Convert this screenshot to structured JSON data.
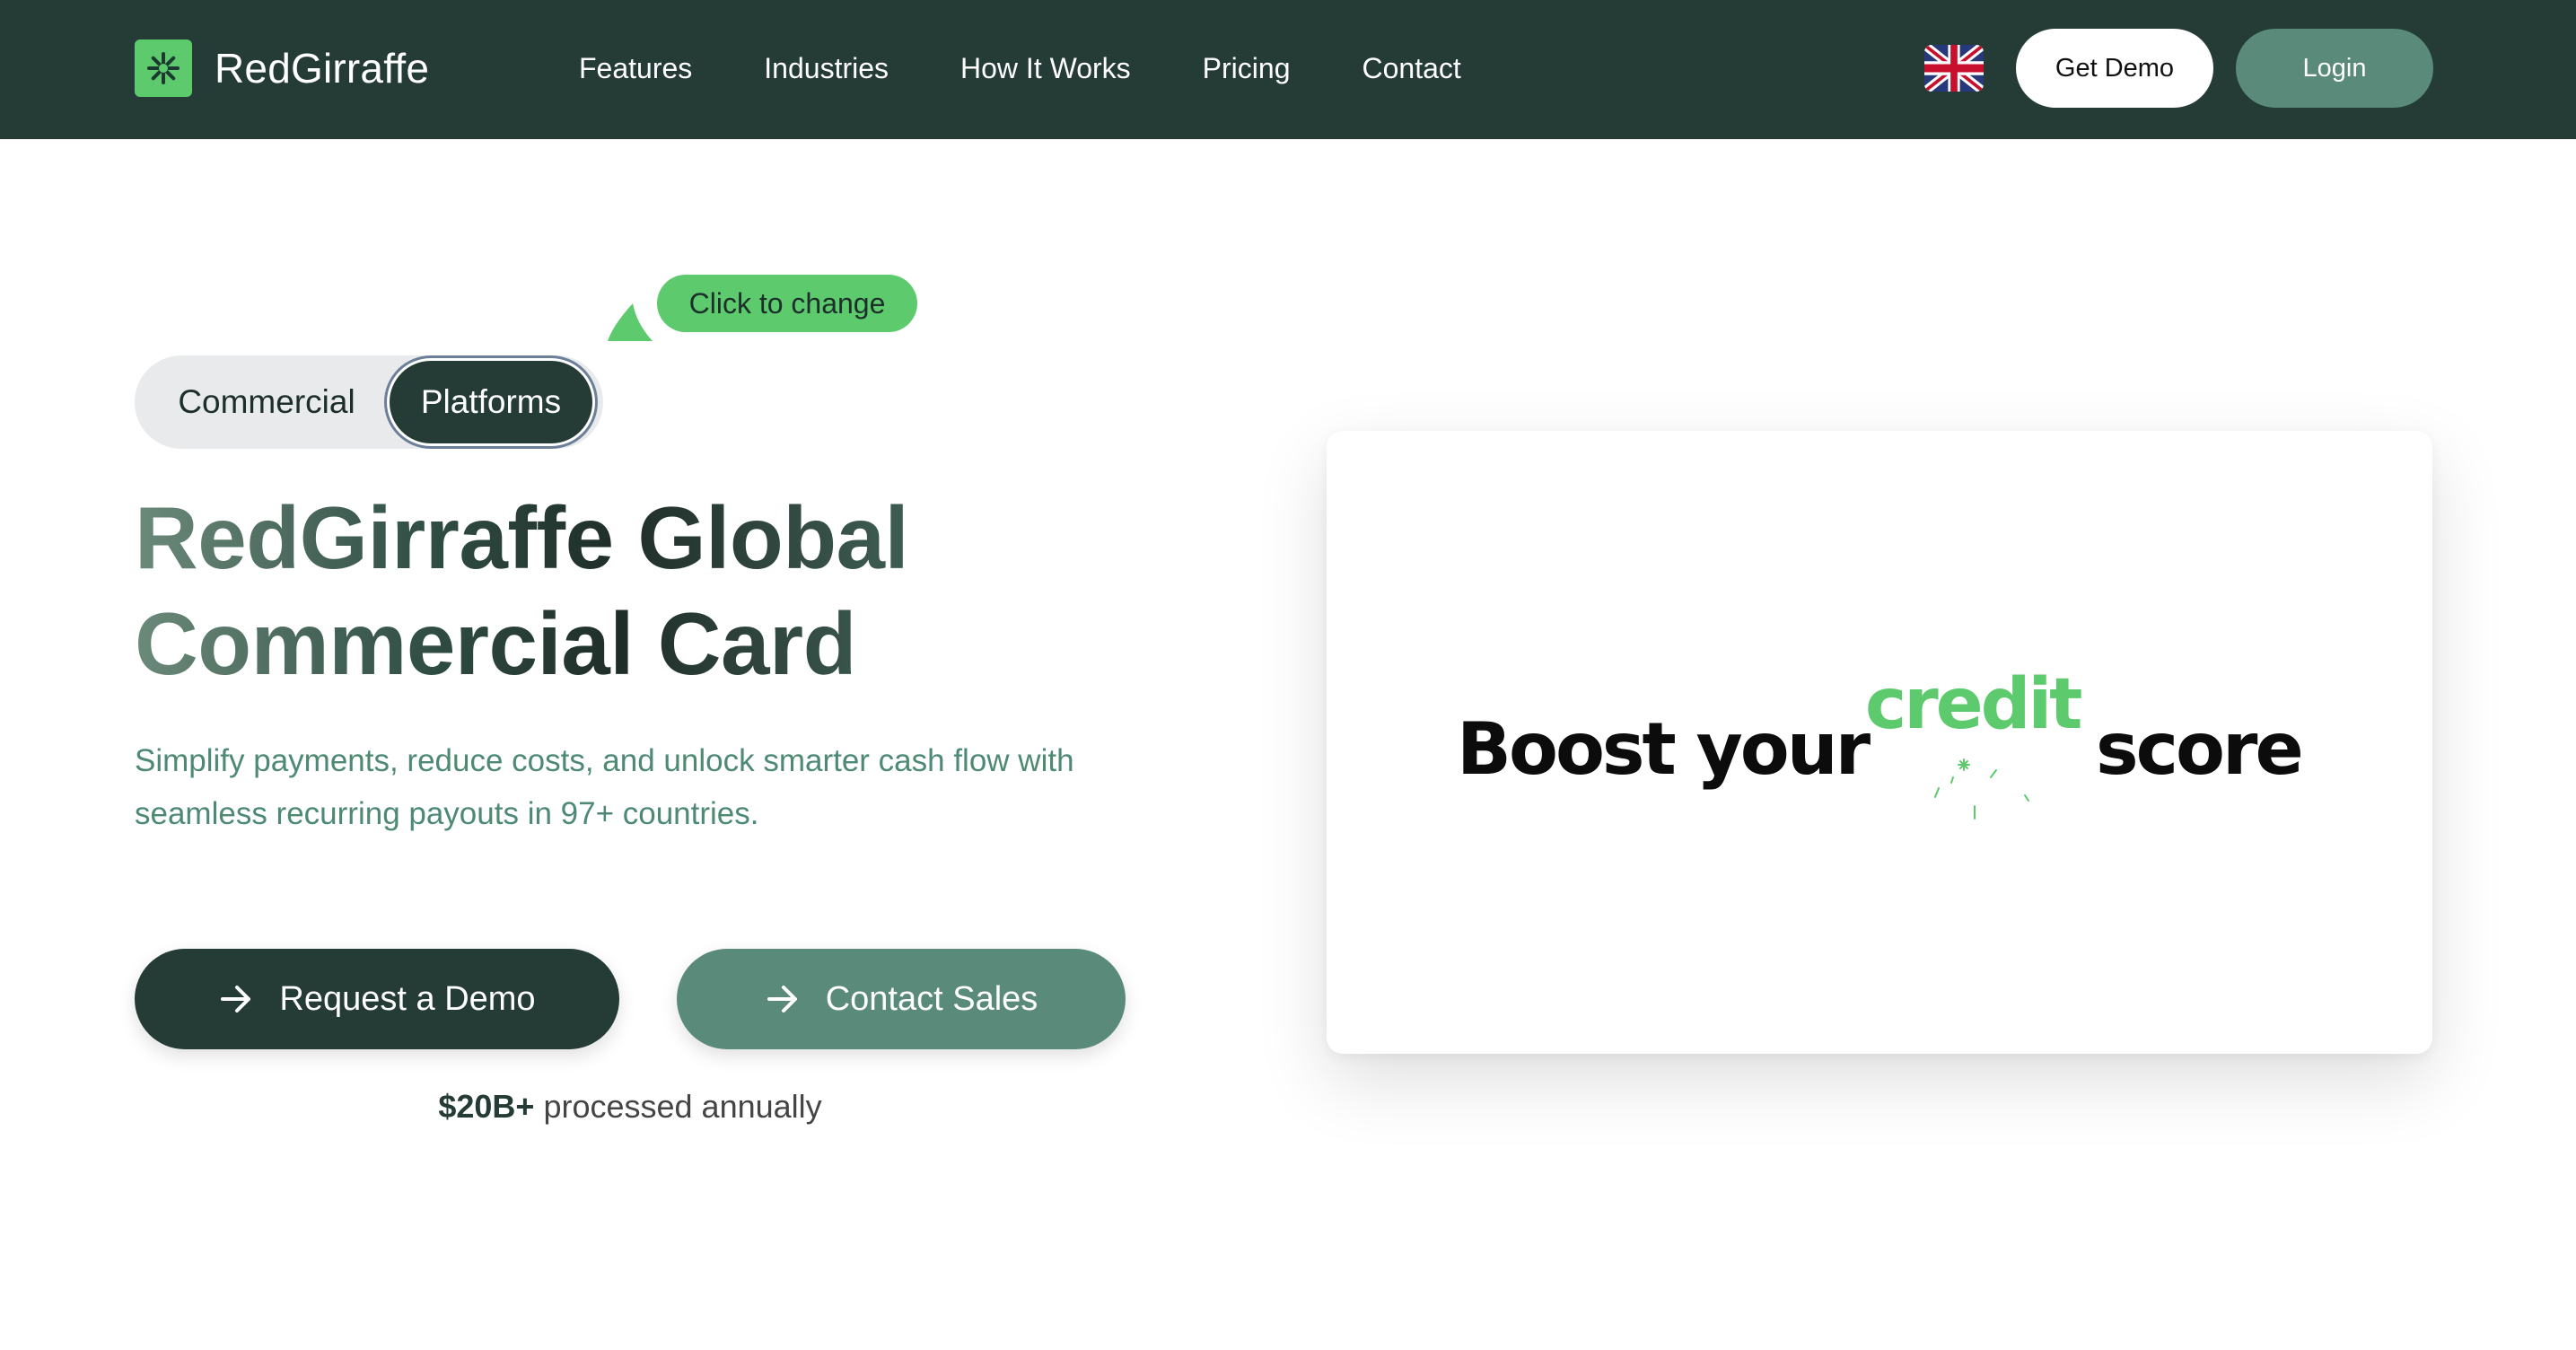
{
  "nav": {
    "brand": "RedGirraffe",
    "links": [
      "Features",
      "Industries",
      "How It Works",
      "Pricing",
      "Contact"
    ],
    "language_icon": "uk-flag-icon",
    "get_demo_label": "Get Demo",
    "login_label": "Login"
  },
  "hero": {
    "tooltip": "Click to change",
    "toggle": {
      "options": [
        "Commercial",
        "Platforms"
      ],
      "selected": "Platforms"
    },
    "headline_line1": "RedGirraffe Global",
    "headline_line2": "Commercial Card",
    "subtitle": "Simplify payments, reduce costs, and unlock smarter cash flow with seamless recurring payouts in 97+ countries.",
    "request_demo_label": "Request a Demo",
    "contact_sales_label": "Contact Sales",
    "stat_value": "$20B+",
    "stat_text": "processed annually"
  },
  "card": {
    "text_before": "Boost your",
    "highlight_word": "credit",
    "text_after": "score"
  },
  "colors": {
    "nav_bg": "#243b36",
    "accent_green": "#5dcb6d",
    "secondary_green": "#5a8a79",
    "subtitle_green": "#4e8a73"
  }
}
